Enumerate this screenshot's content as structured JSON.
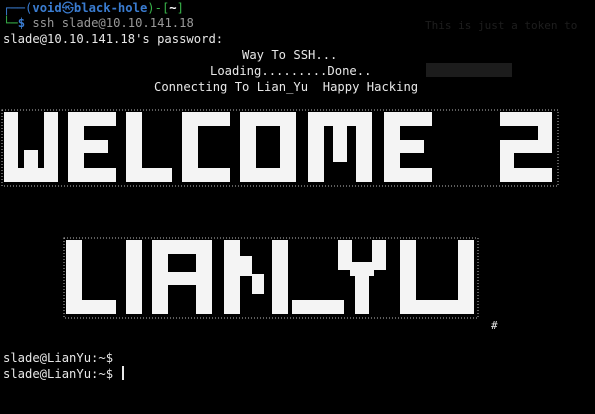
{
  "prompt": {
    "corner_top": "┌──(",
    "user": "void",
    "at_symbol": "㉿",
    "host": "black-hole",
    "dir_open": ")-[",
    "dir": "~",
    "dir_close": "]",
    "corner_bottom": "└─",
    "dollar": "$",
    "command": " ssh slade@10.10.141.18"
  },
  "password_prompt": "slade@10.10.141.18's password:",
  "banner": {
    "line1": "Way To SSH...",
    "line2": "Loading.........Done..",
    "line3": "Connecting To Lian_Yu  Happy Hacking"
  },
  "ascii_art": {
    "word1": "WELCOME2",
    "word2": "LIAN_YU",
    "hash": "#"
  },
  "remote_prompts": [
    "slade@LianYu:~$",
    "slade@LianYu:~$ "
  ],
  "background_ghost_text": "This is just a token to",
  "colors": {
    "background": "#000000",
    "text": "#e8e8e8",
    "prompt_blue": "#3a7cd0",
    "prompt_green": "#38b34a"
  }
}
